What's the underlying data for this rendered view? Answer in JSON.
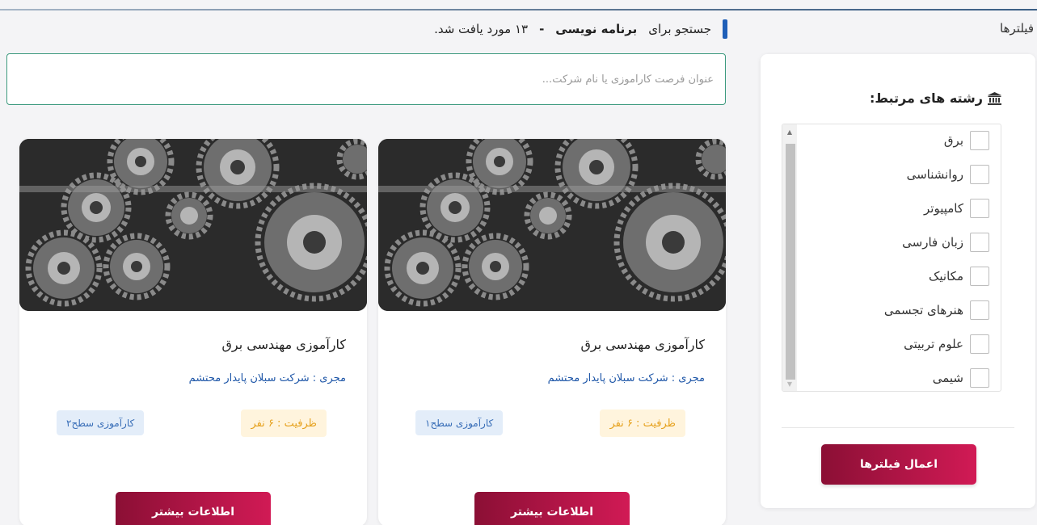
{
  "filters": {
    "title": "فیلترها",
    "fields_title": "رشته های مرتبط:",
    "icon": "bank-icon",
    "fields": [
      {
        "label": "برق",
        "checked": false
      },
      {
        "label": "روانشناسی",
        "checked": false
      },
      {
        "label": "کامپیوتر",
        "checked": false
      },
      {
        "label": "زبان فارسی",
        "checked": false
      },
      {
        "label": "مکانیک",
        "checked": false
      },
      {
        "label": "هنرهای تجسمی",
        "checked": false
      },
      {
        "label": "علوم تربیتی",
        "checked": false
      },
      {
        "label": "شیمی",
        "checked": false
      }
    ],
    "apply_label": "اعمال فیلترها"
  },
  "results": {
    "prefix": "جستجو برای",
    "query": "برنامه نویسی",
    "separator": "-",
    "count_text": "۱۳ مورد یافت شد."
  },
  "search": {
    "placeholder": "عنوان فرصت کارآموزی یا نام شرکت...",
    "value": ""
  },
  "cards": [
    {
      "title": "کارآموزی مهندسی برق",
      "company": "مجری : شرکت سبلان پایدار محتشم",
      "capacity": "ظرفیت : ۶ نفر",
      "level": "کارآموزی سطح۱",
      "button": "اطلاعات بیشتر",
      "image": "gears-image"
    },
    {
      "title": "کارآموزی مهندسی برق",
      "company": "مجری : شرکت سبلان پایدار محتشم",
      "capacity": "ظرفیت : ۶ نفر",
      "level": "کارآموزی سطح۲",
      "button": "اطلاعات بیشتر",
      "image": "gears-image"
    }
  ],
  "colors": {
    "accent": "#1f5fb8",
    "button": "#b3154a",
    "search_border": "#3d9a7e",
    "capacity_bg": "#fff4dd",
    "capacity_text": "#e6a11d",
    "level_bg": "#e3edf9",
    "level_text": "#3a6fb8",
    "company_text": "#1f57a8"
  }
}
